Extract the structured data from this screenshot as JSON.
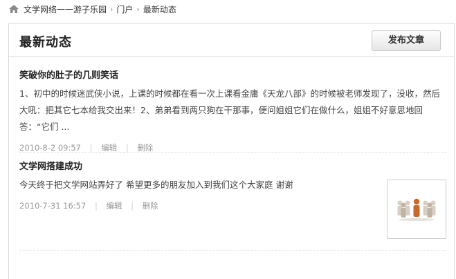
{
  "breadcrumb": {
    "home_icon": "home-icon",
    "items": [
      "文学网络一一游子乐园",
      "门户",
      "最新动态"
    ],
    "separator": "›"
  },
  "header": {
    "title": "最新动态",
    "publish_label": "发布文章"
  },
  "posts": [
    {
      "title": "笑破你的肚子的几则笑话",
      "summary": "1、初中的时候迷武侠小说，上课的时候都在看一次上课看金庸《天龙八部》的时候被老师发现了，没收，然后大吼：把其它七本给我交出来！2、弟弟看到两只狗在干那事，便问姐姐它们在做什么，姐姐不好意思地回答：“它们 ...",
      "date": "2010-8-2 09:57",
      "edit_label": "编辑",
      "delete_label": "删除"
    },
    {
      "title": "文学网搭建成功",
      "summary": "今天终于把文学网站弄好了 希望更多的朋友加入到我们这个大家庭 谢谢",
      "date": "2010-7-31 16:57",
      "edit_label": "编辑",
      "delete_label": "删除",
      "thumbnail_icon": "team-people-icon"
    }
  ],
  "colors": {
    "border": "#d9d9d9",
    "meta_text": "#999999",
    "title_text": "#222222"
  }
}
